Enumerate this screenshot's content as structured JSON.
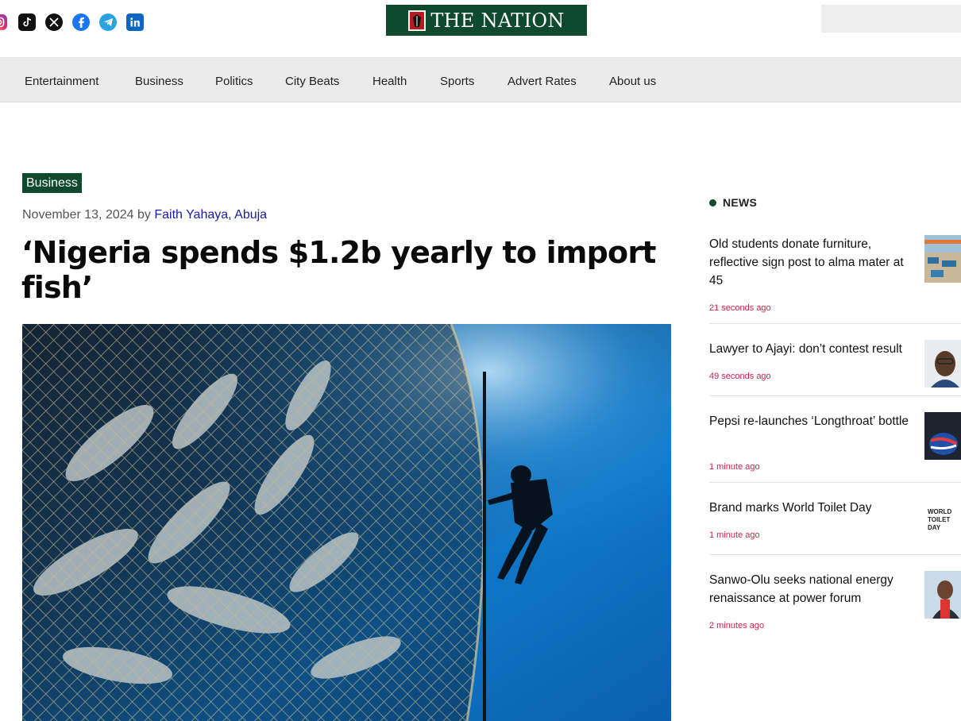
{
  "header": {
    "social_icons": [
      "instagram-icon",
      "tiktok-icon",
      "x-icon",
      "facebook-icon",
      "telegram-icon",
      "linkedin-icon"
    ],
    "logo_text": "THE NATION",
    "colors": {
      "brand_green": "#0f4a2e",
      "accent_red": "#d0214a",
      "link_blue": "#1a1aa6"
    }
  },
  "nav": {
    "items": [
      "Entertainment",
      "Business",
      "Politics",
      "City Beats",
      "Health",
      "Sports",
      "Advert Rates",
      "About us"
    ]
  },
  "article": {
    "category": "Business",
    "date": "November 13, 2024",
    "by": "by",
    "author": "Faith Yahaya, Abuja",
    "title": "‘Nigeria spends $1.2b yearly to import fish’"
  },
  "sidebar": {
    "heading": "NEWS",
    "stories": [
      {
        "title": "Old students donate furniture, reflective sign post to alma mater at 45",
        "time": "21 seconds ago"
      },
      {
        "title": "Lawyer to Ajayi: don’t contest result",
        "time": "49 seconds ago"
      },
      {
        "title": "Pepsi re-launches ‘Longthroat’ bottle",
        "time": "1 minute ago"
      },
      {
        "title": "Brand marks World Toilet Day",
        "time": "1 minute ago",
        "thumb_text": "WORLD TOILET DAY"
      },
      {
        "title": "Sanwo-Olu seeks national energy renaissance at power forum",
        "time": "2 minutes ago"
      }
    ]
  }
}
